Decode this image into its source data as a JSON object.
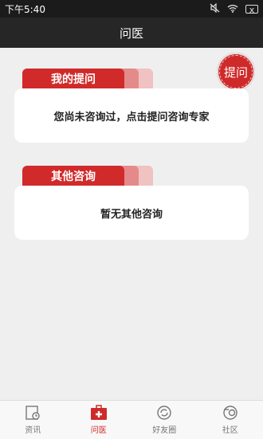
{
  "status_bar": {
    "time": "下午5:40",
    "icons": [
      "mute-icon",
      "wifi-icon",
      "battery-icon"
    ]
  },
  "header": {
    "title": "问医"
  },
  "fab": {
    "label": "提问"
  },
  "sections": [
    {
      "tab_label": "我的提问",
      "message": "您尚未咨询过，点击提问咨询专家"
    },
    {
      "tab_label": "其他咨询",
      "message": "暂无其他咨询"
    }
  ],
  "bottom_nav": {
    "items": [
      {
        "label": "资讯",
        "icon": "news-icon",
        "active": false
      },
      {
        "label": "问医",
        "icon": "medical-kit-icon",
        "active": true
      },
      {
        "label": "好友圈",
        "icon": "friends-circle-icon",
        "active": false
      },
      {
        "label": "社区",
        "icon": "community-icon",
        "active": false
      }
    ]
  },
  "colors": {
    "accent": "#cf2a2a",
    "header_bg": "#262626",
    "page_bg": "#efefef"
  }
}
